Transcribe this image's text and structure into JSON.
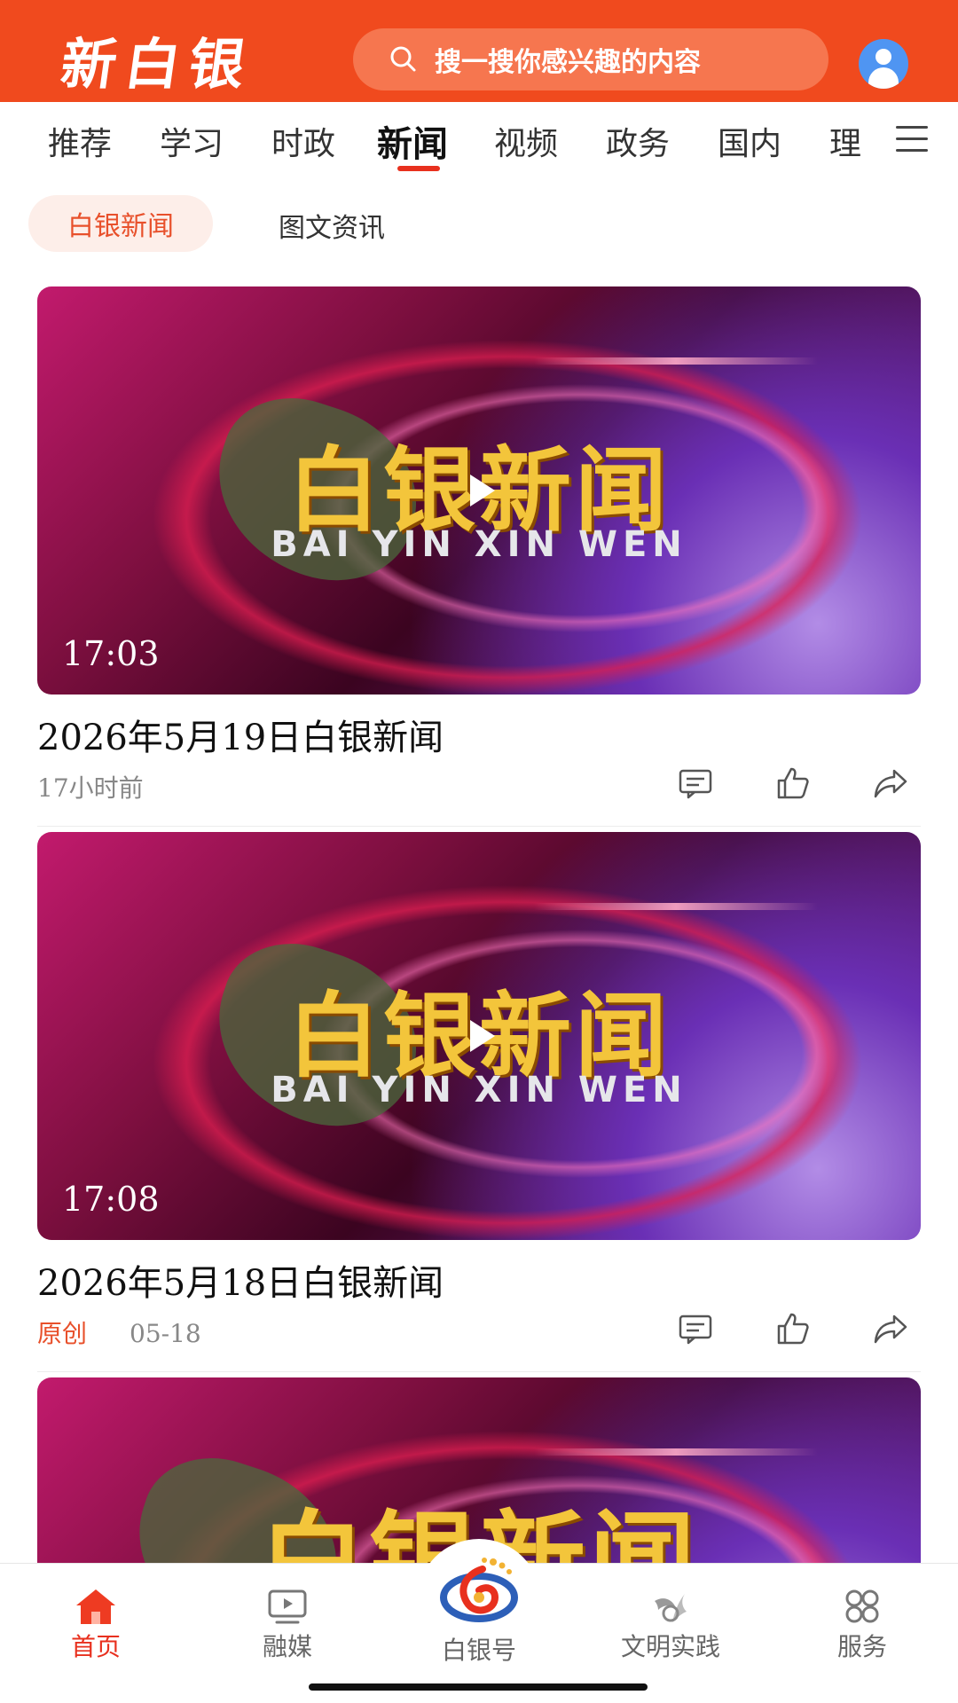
{
  "header": {
    "logo_text": "新白银",
    "search_placeholder": "搜一搜你感兴趣的内容"
  },
  "tabs": [
    {
      "label": "推荐"
    },
    {
      "label": "学习"
    },
    {
      "label": "时政"
    },
    {
      "label": "新闻",
      "active": true
    },
    {
      "label": "视频"
    },
    {
      "label": "政务"
    },
    {
      "label": "国内"
    },
    {
      "label": "理"
    }
  ],
  "subtabs": {
    "active_label": "白银新闻",
    "other_label": "图文资讯"
  },
  "cards": [
    {
      "thumb_title_cn": "白银新闻",
      "thumb_title_en": "BAI YIN XIN WEN",
      "duration": "17:03",
      "title": "2026年5月19日白银新闻",
      "tag": "",
      "time": "17小时前"
    },
    {
      "thumb_title_cn": "白银新闻",
      "thumb_title_en": "BAI YIN XIN WEN",
      "duration": "17:08",
      "title": "2026年5月18日白银新闻",
      "tag": "原创",
      "time": "05-18"
    },
    {
      "thumb_title_cn": "白银新闻"
    }
  ],
  "bottom_nav": [
    {
      "label": "首页",
      "icon": "home-icon",
      "active": true
    },
    {
      "label": "融媒",
      "icon": "tv-icon"
    },
    {
      "label": "白银号",
      "icon": "baiyin-logo-icon"
    },
    {
      "label": "文明实践",
      "icon": "civilization-icon"
    },
    {
      "label": "服务",
      "icon": "grid-icon"
    }
  ],
  "colors": {
    "brand": "#f04a1e",
    "accent": "#e8301e",
    "subtab_bg": "#fdeee9"
  }
}
